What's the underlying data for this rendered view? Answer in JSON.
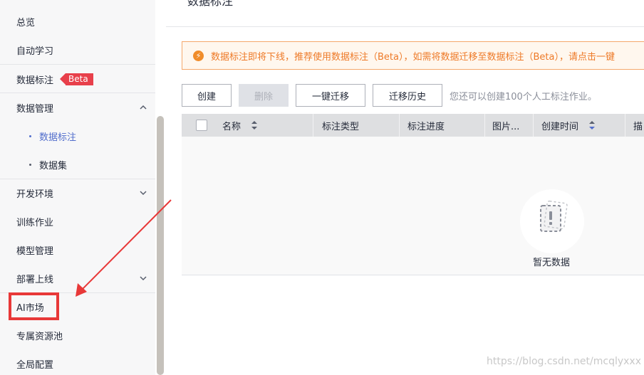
{
  "sidebar": {
    "items": [
      {
        "label": "总览"
      },
      {
        "label": "自动学习"
      },
      {
        "label": "数据标注",
        "badge": "Beta"
      },
      {
        "label": "数据管理",
        "expanded": true,
        "children": [
          {
            "label": "数据标注",
            "active": true
          },
          {
            "label": "数据集",
            "active": false
          }
        ]
      },
      {
        "label": "开发环境",
        "expanded": false
      },
      {
        "label": "训练作业"
      },
      {
        "label": "模型管理"
      },
      {
        "label": "部署上线",
        "expanded": false
      },
      {
        "label": "AI市场",
        "highlighted": true
      },
      {
        "label": "专属资源池"
      },
      {
        "label": "全局配置"
      }
    ]
  },
  "main": {
    "title": "数据标注",
    "notice": {
      "icon": "warning-icon",
      "text": "数据标注即将下线，推荐使用数据标注（Beta），如需将数据迁移至数据标注（Beta），请点击一键"
    },
    "toolbar": {
      "create_label": "创建",
      "delete_label": "删除",
      "migrate_label": "一键迁移",
      "history_label": "迁移历史",
      "hint": "您还可以创建100个人工标注作业。"
    },
    "table": {
      "columns": [
        "名称",
        "标注类型",
        "标注进度",
        "图片...",
        "创建时间",
        "描"
      ],
      "rows": [],
      "empty_text": "暂无数据"
    }
  },
  "watermark": "https://blog.csdn.net/mcqlyxxx",
  "colors": {
    "accent": "#526ecc",
    "badge": "#e8404b",
    "warning": "#ee7a28",
    "annotation": "#e83838"
  }
}
